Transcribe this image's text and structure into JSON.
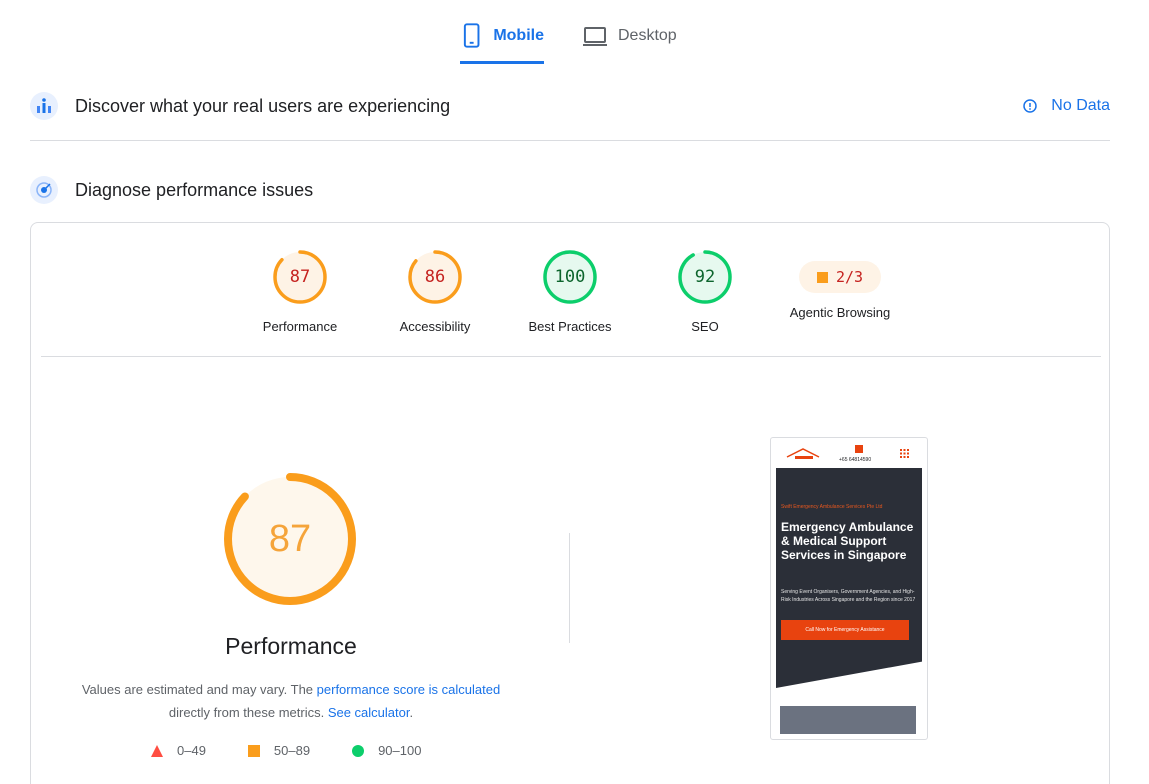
{
  "tabs": {
    "mobile": "Mobile",
    "desktop": "Desktop"
  },
  "field": {
    "title": "Discover what your real users are experiencing",
    "status": "No Data"
  },
  "lab": {
    "title": "Diagnose performance issues"
  },
  "scores": [
    {
      "label": "Performance",
      "value": "87",
      "score": 87,
      "color": "#fa9d1c",
      "fill": "#fef3e6",
      "text_color": "#c5221f"
    },
    {
      "label": "Accessibility",
      "value": "86",
      "score": 86,
      "color": "#fa9d1c",
      "fill": "#fef3e6",
      "text_color": "#c5221f"
    },
    {
      "label": "Best Practices",
      "value": "100",
      "score": 100,
      "color": "#0cce6b",
      "fill": "#e6f9ef",
      "text_color": "#0d652d"
    },
    {
      "label": "SEO",
      "value": "92",
      "score": 92,
      "color": "#0cce6b",
      "fill": "#e6f9ef",
      "text_color": "#0d652d"
    }
  ],
  "agentic": {
    "label": "Agentic Browsing",
    "value": "2/3"
  },
  "main": {
    "score": "87",
    "score_fraction": 0.87,
    "label": "Performance",
    "desc_1": "Values are estimated and may vary. The ",
    "desc_link_1": "performance score is calculated",
    "desc_2": "directly from these metrics. ",
    "desc_link_2": "See calculator",
    "desc_3": "."
  },
  "legend": [
    {
      "range": "0–49",
      "shape": "triangle",
      "color": "#ff4e42"
    },
    {
      "range": "50–89",
      "shape": "square",
      "color": "#fa9d1c"
    },
    {
      "range": "90–100",
      "shape": "circle",
      "color": "#0cce6b"
    }
  ],
  "screenshot": {
    "phone": "+65 64814590",
    "tag": "Swift Emergency Ambulance Services Pte Ltd",
    "title": "Emergency Ambulance & Medical Support Services in Singapore",
    "subtitle": "Serving Event Organisers, Government Agencies, and High-Risk Industries Across Singapore and the Region since 2017",
    "cta": "Call Now for Emergency Assistance"
  }
}
